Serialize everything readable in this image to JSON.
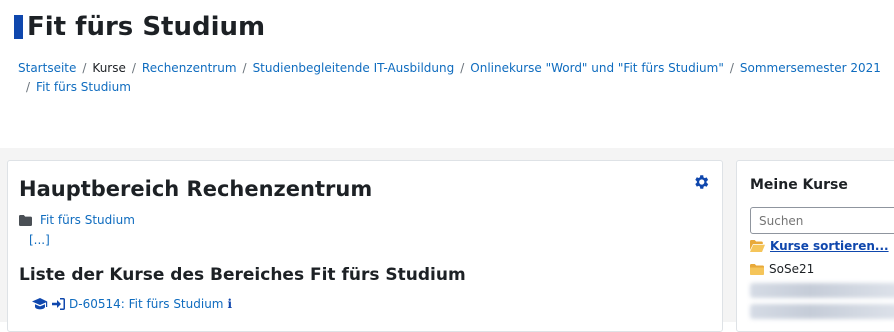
{
  "header": {
    "title": "Fit fürs Studium"
  },
  "breadcrumb": {
    "items": [
      "Startseite",
      "Kurse",
      "Rechenzentrum",
      "Studienbegleitende IT-Ausbildung",
      "Onlinekurse \"Word\" und \"Fit fürs Studium\"",
      "Sommersemester 2021",
      "Fit fürs Studium"
    ],
    "separator": "/"
  },
  "main": {
    "heading": "Hauptbereich Rechenzentrum",
    "category_link": "Fit fürs Studium",
    "more_link": "[...]",
    "list_heading": "Liste der Kurse des Bereiches Fit fürs Studium",
    "course_link": "D-60514: Fit fürs Studium"
  },
  "sidebar": {
    "heading": "Meine Kurse",
    "search_placeholder": "Suchen",
    "sort_link": "Kurse sortieren...",
    "term_label": "SoSe21"
  },
  "icons": {
    "settings": "gear-icon",
    "category": "folder-icon",
    "course": "graduation-cap-icon",
    "enrol": "sign-in-icon",
    "info": "info-icon",
    "sort": "folder-open-icon",
    "term": "folder-icon"
  },
  "colors": {
    "link": "#0f6cbf",
    "accent": "#0f47ad",
    "text": "#1d2125",
    "background": "#f4f4f4"
  }
}
